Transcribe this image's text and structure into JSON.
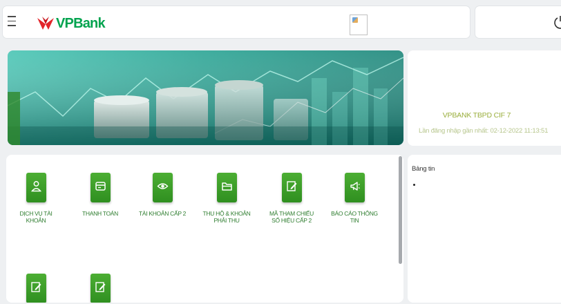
{
  "header": {
    "menu_icon": "hamburger-menu-icon",
    "logo_text": "VPBank",
    "logo_color": "#00a34e",
    "logo_mark_color": "#e3262b",
    "power_icon": "power-icon"
  },
  "profile": {
    "name": "VPBANK TBPD CIF 7",
    "last_login": "Lần đăng nhập gần nhất: 02-12-2022 11:13:51"
  },
  "services": [
    {
      "label": "DỊCH VỤ TÀI KHOẢN",
      "icon": "user-icon"
    },
    {
      "label": "THANH TOÁN",
      "icon": "card-icon"
    },
    {
      "label": "TÀI KHOẢN CẤP 2",
      "icon": "eye-icon"
    },
    {
      "label": "THU HỘ & KHOẢN PHẢI THU",
      "icon": "folder-icon"
    },
    {
      "label": "MÃ THAM CHIẾU SỐ HIỆU CẤP 2",
      "icon": "edit-icon"
    },
    {
      "label": "BÁO CÁO THÔNG TIN",
      "icon": "megaphone-icon"
    },
    {
      "label": "",
      "icon": "edit-icon"
    },
    {
      "label": "",
      "icon": "edit-icon"
    }
  ],
  "news": {
    "title": "Bảng tin",
    "items": [
      ""
    ]
  },
  "colors": {
    "accent_green": "#4cae33",
    "label_green": "#2e7d2f",
    "profile_name": "#9aae3c"
  }
}
